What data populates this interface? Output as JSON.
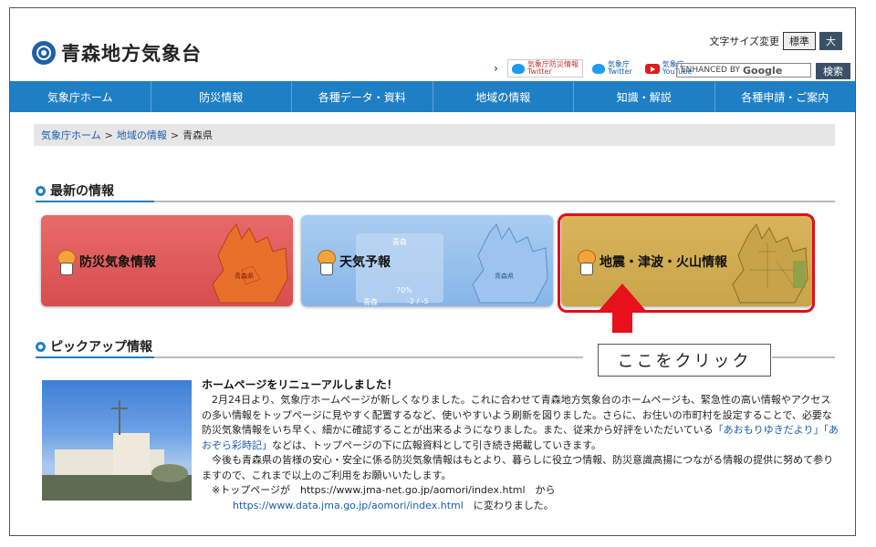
{
  "header": {
    "site_title": "青森地方気象台",
    "font_size_label": "文字サイズ変更",
    "font_standard": "標準",
    "font_large": "大",
    "social": [
      {
        "icon": "twitter-icon",
        "line1": "気象庁防災情報",
        "line2": "Twitter"
      },
      {
        "icon": "twitter-icon",
        "line1": "気象庁",
        "line2": "Twitter"
      },
      {
        "icon": "youtube-icon",
        "line1": "気象庁",
        "line2": "YouTube"
      }
    ],
    "search_prefix": "ENHANCED BY",
    "search_brand": "Google",
    "search_button": "検索"
  },
  "nav": [
    "気象庁ホーム",
    "防災情報",
    "各種データ・資料",
    "地域の情報",
    "知識・解説",
    "各種申請・ご案内"
  ],
  "breadcrumb": {
    "home": "気象庁ホーム",
    "sep": ">",
    "region": "地域の情報",
    "current": "青森県"
  },
  "latest": {
    "title": "最新の情報",
    "cards": [
      {
        "label": "防災気象情報",
        "color": "#d84e4e",
        "map_label": "青森県"
      },
      {
        "label": "天気予報",
        "color": "#86b6e8",
        "map_label": "青森県",
        "weather_city": "青森",
        "pop": "70%",
        "temps": "-2 / -5"
      },
      {
        "label": "地震・津波・火山情報",
        "color": "#c9a449"
      }
    ]
  },
  "annotation": {
    "callout": "ここをクリック",
    "arrow_color": "#e8101a"
  },
  "pickup": {
    "title": "ピックアップ情報",
    "news_title": "ホームページをリニューアルしました！",
    "p1a": "　2月24日より、気象庁ホームページが新しくなりました。これに合わせて青森地方気象台のホームページも、緊急性の高い情報やアクセスの多い情報をトップページに見やすく配置するなど、使いやすいよう刷新を図りました。さらに、お住いの市町村を設定することで、必要な防災気象情報をいち早く、細かに確認することが出来るようになりました。また、従来から好評をいただいている",
    "link1": "「あおもりゆきだより」",
    "link2": "「あおぞら彩時記」",
    "p1b": "などは、トップページの下に広報資料として引き続き掲載していきます。",
    "p2": "　今後も青森県の皆様の安心・安全に係る防災気象情報はもとより、暮らしに役立つ情報、防災意識高揚につながる情報の提供に努めて参りますので、これまで以上のご利用をお願いいたします。",
    "p3a": "　※トップページが　https://www.jma-net.go.jp/aomori/index.html　から",
    "p3_url": "https://www.data.jma.go.jp/aomori/index.html",
    "p3b": "　に変わりました。"
  },
  "colors": {
    "nav": "#1f7fc4",
    "accent": "#1b5db0",
    "highlight": "#e0101a"
  }
}
